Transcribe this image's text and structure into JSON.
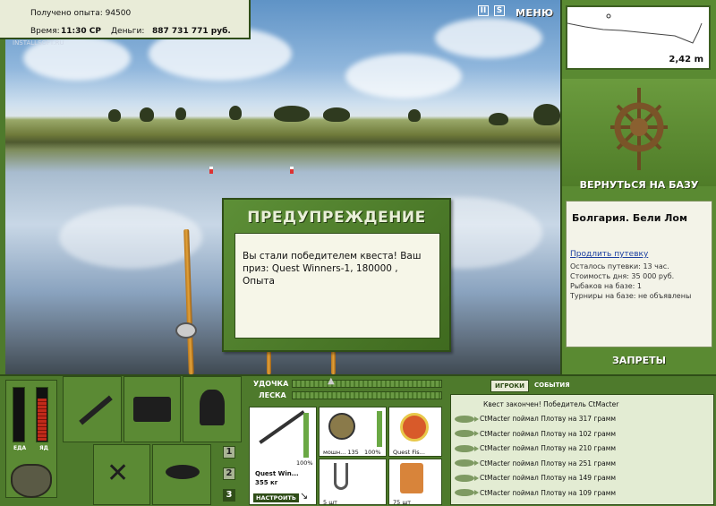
{
  "hud": {
    "exp_label": "Получено опыта: 94500",
    "time_label": "Время:",
    "time_value": "11:30 СР",
    "money_label": "Деньги:",
    "money_value": "887 731 771 руб.",
    "watermark": "INSTALLSOFT.RU"
  },
  "top_buttons": {
    "pause": "II",
    "sound": "S",
    "menu": "МЕНЮ"
  },
  "depth": {
    "value": "2,42 m"
  },
  "side": {
    "back_to_base": "ВЕРНУТЬСЯ НА БАЗУ",
    "location_title": "Болгария. Бели Лом",
    "extend_link": "Продлить путевку",
    "stats": [
      "Осталось путевки: 13 час.",
      "Стоимость дня: 35 000 руб.",
      "Рыбаков на базе: 1",
      "Турниры на базе: не объявлены"
    ],
    "bans": "ЗАПРЕТЫ"
  },
  "dialog": {
    "title": "ПРЕДУПРЕЖДЕНИЕ",
    "message": "Вы стали победителем квеста! Ваш приз: Quest Winners-1, 180000 , Опыта"
  },
  "meters": {
    "food_label": "ЕДА",
    "poison_label": "ЯД",
    "food_level": 0.0,
    "poison_level": 0.78
  },
  "slots": {
    "numbers": [
      "1",
      "2",
      "3"
    ]
  },
  "tackle": {
    "rod_label": "УДОЧКА",
    "line_label": "ЛЕСКА",
    "rod_name": "Quest Win...",
    "rod_weight": "355 кг",
    "rod_pct": "100%",
    "reel_label": "мошн... 135",
    "reel_pct": "100%",
    "line_name": "Quest Fis...",
    "hook_qty": "5 шт",
    "bait_qty": "75 шт",
    "setup_button": "НАСТРОИТЬ"
  },
  "chat": {
    "tab_players": "ИГРОКИ",
    "tab_events": "СОБЫТИЯ",
    "header": "Квест закончен! Победитель CtMacter",
    "lines": [
      "CtMacter поймал Плотву на 317 грамм",
      "CtMacter поймал Плотву на 102 грамм",
      "CtMacter поймал Плотву на 210 грамм",
      "CtMacter поймал Плотву на 251 грамм",
      "CtMacter поймал Плотву на 149 грамм",
      "CtMacter поймал Плотву на 109 грамм"
    ]
  }
}
